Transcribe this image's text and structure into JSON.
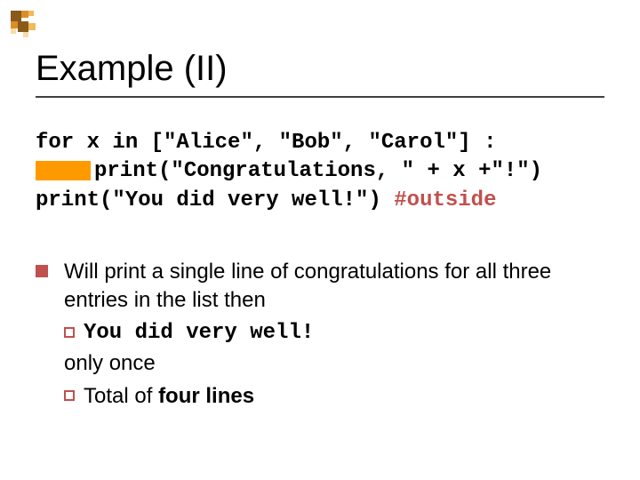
{
  "title": "Example (II)",
  "code": {
    "line1": "for x in [\"Alice\", \"Bob\", \"Carol\"] :",
    "line2_text": "print(\"Congratulations, \" + x +\"!\")",
    "line3_main": "print(\"You did very well!\") ",
    "line3_comment": "#outside"
  },
  "bullets": {
    "main": "Will print a single line of congratulations for all three entries in the list then",
    "sub1": "You did very well!",
    "after1": "only once",
    "sub2_prefix": "Total ",
    "sub2_rest": "of ",
    "sub2_bold": "four lines"
  },
  "logo_colors": {
    "dark": "#8a5a1a",
    "mid": "#d98e2b",
    "light": "#f0b95a",
    "pale": "#f7dca8"
  }
}
